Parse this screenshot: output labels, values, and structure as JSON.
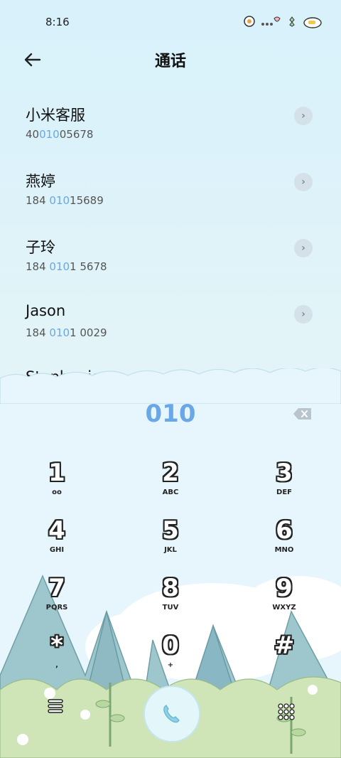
{
  "status": {
    "time": "8:16"
  },
  "header": {
    "title": "通话"
  },
  "contacts": [
    {
      "name": "小米客服",
      "num_pre": "40",
      "num_hl": "010",
      "num_post": "05678"
    },
    {
      "name": "燕婷",
      "num_pre": "184 ",
      "num_hl": "010",
      "num_post": "15689"
    },
    {
      "name": "子玲",
      "num_pre": "184 ",
      "num_hl": "010",
      "num_post": "1 5678"
    },
    {
      "name": "Jason",
      "num_pre": "184 ",
      "num_hl": "010",
      "num_post": "1 0029"
    },
    {
      "name": "Stephanie",
      "num_pre": "",
      "num_hl": "",
      "num_post": ""
    }
  ],
  "dialer": {
    "digits": "010",
    "keys": [
      {
        "d": "1",
        "l": "oo"
      },
      {
        "d": "2",
        "l": "ABC"
      },
      {
        "d": "3",
        "l": "DEF"
      },
      {
        "d": "4",
        "l": "GHI"
      },
      {
        "d": "5",
        "l": "JKL"
      },
      {
        "d": "6",
        "l": "MNO"
      },
      {
        "d": "7",
        "l": "PQRS"
      },
      {
        "d": "8",
        "l": "TUV"
      },
      {
        "d": "9",
        "l": "WXYZ"
      },
      {
        "d": "*",
        "l": ","
      },
      {
        "d": "0",
        "l": "+"
      },
      {
        "d": "#",
        "l": ""
      }
    ]
  },
  "icons": {
    "back": "arrow-left-icon",
    "backspace": "backspace-icon",
    "call": "phone-icon",
    "menu": "menu-icon",
    "keypad": "dialpad-icon"
  },
  "colors": {
    "highlight": "#6aa7e6"
  }
}
